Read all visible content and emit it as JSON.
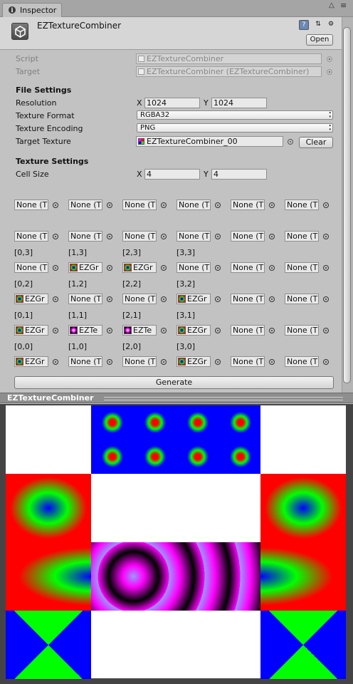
{
  "tab": {
    "label": "Inspector"
  },
  "header": {
    "title": "EZTextureCombiner",
    "open_label": "Open"
  },
  "script_row": {
    "label": "Script",
    "value": "EZTextureCombiner"
  },
  "target_row": {
    "label": "Target",
    "value": "EZTextureCombiner (EZTextureCombiner)"
  },
  "file_settings": {
    "title": "File Settings",
    "resolution": {
      "label": "Resolution",
      "x_label": "X",
      "x": "1024",
      "y_label": "Y",
      "y": "1024"
    },
    "format": {
      "label": "Texture Format",
      "value": "RGBA32"
    },
    "encoding": {
      "label": "Texture Encoding",
      "value": "PNG"
    },
    "target_texture": {
      "label": "Target Texture",
      "value": "EZTextureCombiner_00",
      "clear_label": "Clear"
    }
  },
  "texture_settings": {
    "title": "Texture Settings",
    "cell_size": {
      "label": "Cell Size",
      "x_label": "X",
      "x": "4",
      "y_label": "Y",
      "y": "4"
    }
  },
  "grid": {
    "rows": [
      {
        "coords": [
          "",
          "",
          "",
          "",
          "",
          ""
        ],
        "cells": [
          "None (T",
          "None (T",
          "None (T",
          "None (T",
          "None (T",
          "None (T"
        ]
      },
      {
        "coords": [
          "",
          "",
          "",
          "",
          "",
          ""
        ],
        "cells": [
          "None (T",
          "None (T",
          "None (T",
          "None (T",
          "None (T",
          "None (T"
        ]
      },
      {
        "coords": [
          "[0,3]",
          "[1,3]",
          "[2,3]",
          "[3,3]",
          "",
          ""
        ],
        "cells": [
          "None (T",
          "EZGr",
          "EZGr",
          "None (T",
          "None (T",
          "None (T"
        ]
      },
      {
        "coords": [
          "[0,2]",
          "[1,2]",
          "[2,2]",
          "[3,2]",
          "",
          ""
        ],
        "cells": [
          "EZGr",
          "None (T",
          "None (T",
          "EZGr",
          "None (T",
          "None (T"
        ]
      },
      {
        "coords": [
          "[0,1]",
          "[1,1]",
          "[2,1]",
          "[3,1]",
          "",
          ""
        ],
        "cells": [
          "EZGr",
          "EZTe",
          "EZTe",
          "EZGr",
          "None (T",
          "None (T"
        ]
      },
      {
        "coords": [
          "[0,0]",
          "[1,0]",
          "[2,0]",
          "[3,0]",
          "",
          ""
        ],
        "cells": [
          "EZGr",
          "None (T",
          "None (T",
          "EZGr",
          "None (T",
          "None (T"
        ]
      }
    ]
  },
  "generate_label": "Generate",
  "preview": {
    "title": "EZTextureCombiner"
  },
  "colors": {
    "red": "#ff0000",
    "green": "#00ff00",
    "blue": "#0000ff",
    "magenta": "#ff00ff",
    "panel": "#c2c2c2"
  }
}
